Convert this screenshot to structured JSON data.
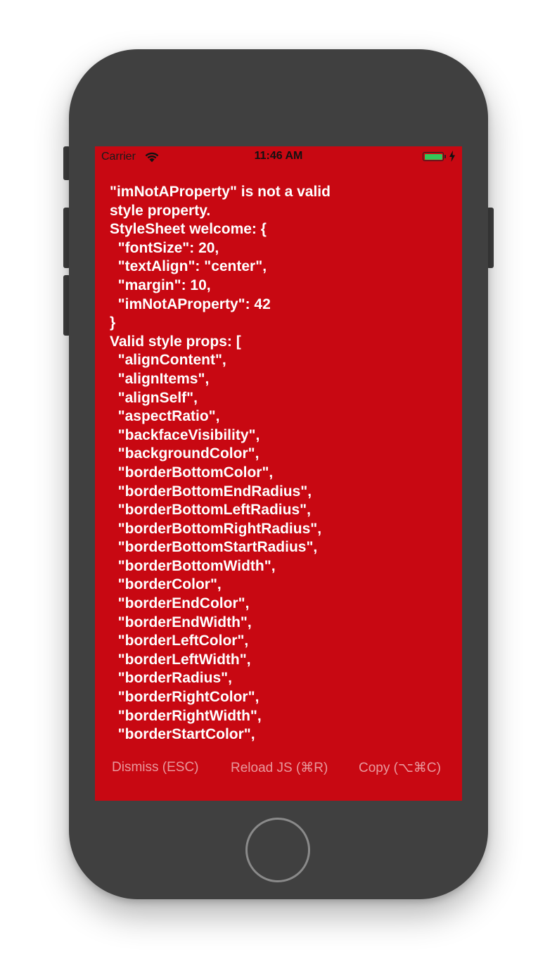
{
  "status_bar": {
    "carrier": "Carrier",
    "time": "11:46 AM",
    "battery_level": 1.0,
    "icons": [
      "wifi-icon",
      "battery-icon",
      "charging-bolt-icon"
    ]
  },
  "error": {
    "lines": [
      "\"imNotAProperty\" is not a valid",
      "style property.",
      "StyleSheet welcome: {",
      "  \"fontSize\": 20,",
      "  \"textAlign\": \"center\",",
      "  \"margin\": 10,",
      "  \"imNotAProperty\": 42",
      "}",
      "Valid style props: [",
      "  \"alignContent\",",
      "  \"alignItems\",",
      "  \"alignSelf\",",
      "  \"aspectRatio\",",
      "  \"backfaceVisibility\",",
      "  \"backgroundColor\",",
      "  \"borderBottomColor\",",
      "  \"borderBottomEndRadius\",",
      "  \"borderBottomLeftRadius\",",
      "  \"borderBottomRightRadius\",",
      "  \"borderBottomStartRadius\",",
      "  \"borderBottomWidth\",",
      "  \"borderColor\",",
      "  \"borderEndColor\",",
      "  \"borderEndWidth\",",
      "  \"borderLeftColor\",",
      "  \"borderLeftWidth\",",
      "  \"borderRadius\",",
      "  \"borderRightColor\",",
      "  \"borderRightWidth\",",
      "  \"borderStartColor\","
    ]
  },
  "actions": {
    "dismiss": "Dismiss (ESC)",
    "reload": "Reload JS (⌘R)",
    "copy": "Copy (⌥⌘C)"
  },
  "colors": {
    "redbox_background": "#c80812",
    "device_body": "#404040",
    "battery_fill": "#35c759",
    "text": "#ffffff"
  }
}
